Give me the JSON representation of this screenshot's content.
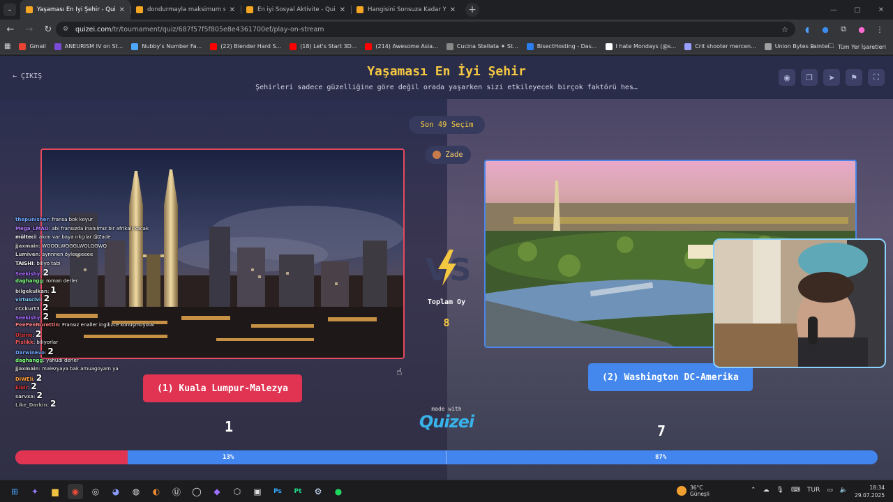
{
  "browser": {
    "tabs": [
      {
        "title": "Yaşaması En İyi Şehir - Quizei",
        "active": true
      },
      {
        "title": "dondurmayla maksimum sarası",
        "active": false
      },
      {
        "title": "En iyi Sosyal Aktivite - Quizei",
        "active": false
      },
      {
        "title": "Hangisini Sonsuza Kadar Yasakl",
        "active": false
      }
    ],
    "url_host": "quizei.com",
    "url_path": "/tr/tournament/quiz/687f57f5f805e8e4361700ef/play-on-stream",
    "bookmarks": [
      {
        "label": "Gmail",
        "color": "#ea4335"
      },
      {
        "label": "ANEURISM IV on St...",
        "color": "#7a4bd6"
      },
      {
        "label": "Nubby's Number Fa...",
        "color": "#4da6ff"
      },
      {
        "label": "(22) Blender Hard S...",
        "color": "#ff0000"
      },
      {
        "label": "(18) Let's Start 3D...",
        "color": "#ff0000"
      },
      {
        "label": "(214) Awesome Asia...",
        "color": "#ff0000"
      },
      {
        "label": "Cucina Stellata ✦ St...",
        "color": "#888888"
      },
      {
        "label": "BisectHosting - Das...",
        "color": "#2a7ef0"
      },
      {
        "label": "I hate Mondays (@s...",
        "color": "#ffffff"
      },
      {
        "label": "Crit shooter mercen...",
        "color": "#9aa0ff"
      },
      {
        "label": "Union Bytes Painter...",
        "color": "#a0a0a0"
      }
    ],
    "all_bookmarks": "Tüm Yer İşaretleri"
  },
  "page": {
    "exit_label": "ÇIKIŞ",
    "title": "Yaşaması En İyi Şehir",
    "subtitle": "Şehirleri sadece güzelliğine göre değil orada yaşarken sizi etkileyecek birçok faktörü hes…",
    "round_label": "Son 49 Seçim",
    "user_name": "Zade",
    "total_votes_label": "Toplam Oy",
    "total_votes_value": "8",
    "made_with": "made with",
    "brand": "Quizei",
    "left": {
      "label": "(1) Kuala Lumpur-Malezya",
      "votes": "1",
      "percent": 13
    },
    "right": {
      "label": "(2) Washington DC-Amerika",
      "votes": "7",
      "percent": 87
    },
    "left_percent_label": "13%",
    "right_percent_label": "87%"
  },
  "chat": [
    {
      "user": "thepunisher",
      "color": "#6fa8ff",
      "msg": "fransa bok koyur",
      "num": ""
    },
    {
      "user": "Mega_LMAO",
      "color": "#b27cff",
      "msg": "abi fransızda inanılmız bir afrikalı kaçak",
      "num": ""
    },
    {
      "user": "mülteci",
      "color": "#ffffff",
      "msg": "akını var baya ırkçılar @Zade",
      "num": ""
    },
    {
      "user": "jjaxmain",
      "color": "#cfcfcf",
      "msg": "WOOOLWQGGLWOLQGWQ",
      "num": ""
    },
    {
      "user": "Lumiven",
      "color": "#cfcfcf",
      "msg": "aynnnen öyleeeeeee",
      "num": ""
    },
    {
      "user": "TAISHI",
      "color": "#ffffff",
      "msg": "biliyo tabi",
      "num": ""
    },
    {
      "user": "Seekishy",
      "color": "#a96bff",
      "msg": "",
      "num": "2"
    },
    {
      "user": "daghangg",
      "color": "#7fff7f",
      "msg": "roman derler",
      "num": ""
    },
    {
      "user": "bilgekulkan",
      "color": "#cfcfcf",
      "msg": "",
      "num": "1"
    },
    {
      "user": "virtuscivi",
      "color": "#7fd4ff",
      "msg": "",
      "num": "2"
    },
    {
      "user": "cCckurt3",
      "color": "#cfcfcf",
      "msg": "",
      "num": "2"
    },
    {
      "user": "Seekishy",
      "color": "#a96bff",
      "msg": "",
      "num": "2"
    },
    {
      "user": "PeePeeNurettin",
      "color": "#ff7f7f",
      "msg": "Fransız enaller ingilizce konuşmuyolar",
      "num": ""
    },
    {
      "user": "Ulsino",
      "color": "#e03a3a",
      "msg": "",
      "num": "2"
    },
    {
      "user": "Pislikk",
      "color": "#ff5f5f",
      "msg": "biliyorlar",
      "num": ""
    },
    {
      "user": "DarwinEvo",
      "color": "#6fa8ff",
      "msg": "",
      "num": "2"
    },
    {
      "user": "daghangg",
      "color": "#7fff7f",
      "msg": "yahudi derler",
      "num": ""
    },
    {
      "user": "jjaxmain",
      "color": "#cfcfcf",
      "msg": "malezyaya bak amuagoyam ya",
      "num": ""
    },
    {
      "user": "DiWEli",
      "color": "#ff9f40",
      "msg": "",
      "num": "2"
    },
    {
      "user": "Eluir",
      "color": "#e03a3a",
      "msg": "",
      "num": "2"
    },
    {
      "user": "sarvxa",
      "color": "#cfcfcf",
      "msg": "",
      "num": "2"
    },
    {
      "user": "Like_Darkin",
      "color": "#aaaaaa",
      "msg": "",
      "num": "2"
    }
  ],
  "taskbar": {
    "temperature": "36°C",
    "weather": "Güneşli",
    "lang": "TUR",
    "time": "18:34",
    "date": "29.07.2025"
  },
  "colors": {
    "accent_yellow": "#f5c842",
    "left_red": "#e03452",
    "right_blue": "#4488ee"
  }
}
